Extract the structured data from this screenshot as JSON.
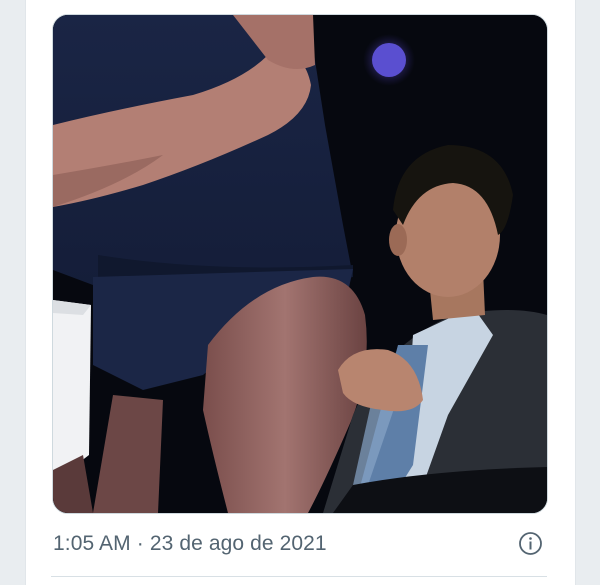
{
  "tweet": {
    "time": "1:05 AM",
    "separator": "·",
    "date": "23 de ago de 2021"
  },
  "icons": {
    "info": "info-icon"
  },
  "colors": {
    "meta_text": "#536471",
    "divider": "#d8e0e5",
    "background": "#e9edf0"
  }
}
